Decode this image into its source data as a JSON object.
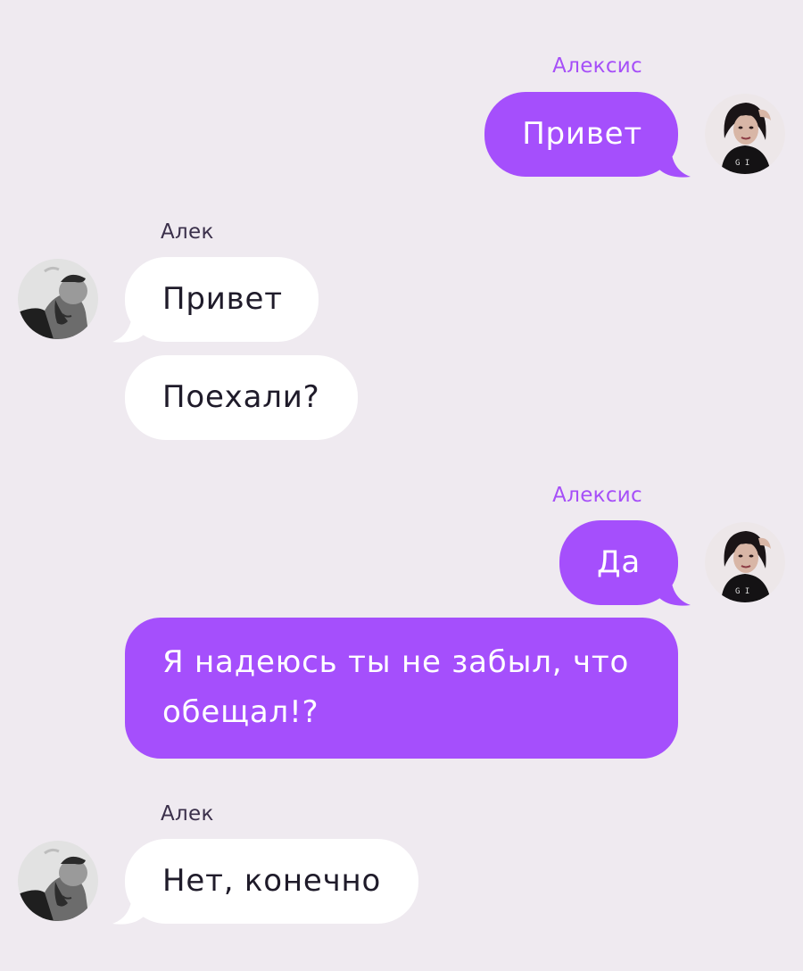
{
  "colors": {
    "background": "#efeaf0",
    "outgoing_bubble": "#a54ffc",
    "incoming_bubble": "#ffffff",
    "outgoing_name": "#a64ff8",
    "incoming_name": "#3a2f4a"
  },
  "chat": {
    "groups": [
      {
        "sender": "Алексис",
        "direction": "outgoing",
        "avatar": "woman-avatar",
        "messages": [
          "Привет"
        ]
      },
      {
        "sender": "Алек",
        "direction": "incoming",
        "avatar": "man-avatar",
        "messages": [
          "Привет",
          "Поехали?"
        ]
      },
      {
        "sender": "Алексис",
        "direction": "outgoing",
        "avatar": "woman-avatar",
        "messages": [
          "Да",
          "Я надеюсь ты не забыл, что обещал!?"
        ]
      },
      {
        "sender": "Алек",
        "direction": "incoming",
        "avatar": "man-avatar",
        "messages": [
          "Нет, конечно"
        ]
      }
    ]
  }
}
